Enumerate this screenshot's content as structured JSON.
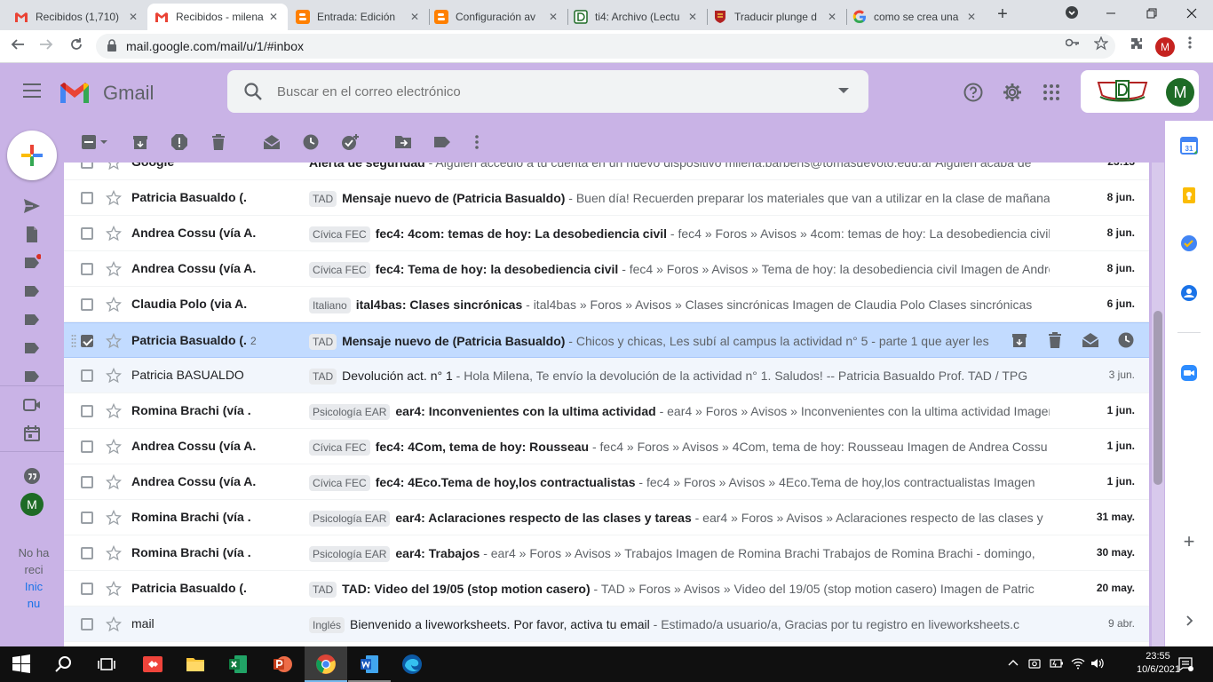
{
  "browser": {
    "tabs": [
      {
        "title": "Recibidos (1,710)",
        "icon": "gmail-icon",
        "active": false
      },
      {
        "title": "Recibidos - milena",
        "icon": "gmail-icon",
        "active": true
      },
      {
        "title": "Entrada: Edición",
        "icon": "blogger-icon",
        "active": false
      },
      {
        "title": "Configuración av",
        "icon": "blogger-icon",
        "active": false
      },
      {
        "title": "ti4: Archivo (Lectu",
        "icon": "moodle-icon",
        "active": false
      },
      {
        "title": "Traducir plunge d",
        "icon": "cambridge-icon",
        "active": false
      },
      {
        "title": "como se crea una",
        "icon": "google-icon",
        "active": false
      }
    ],
    "new_tab": "+",
    "url": "mail.google.com/mail/u/1/#inbox",
    "profile_initial": "M"
  },
  "gmail": {
    "logo_text": "Gmail",
    "search_placeholder": "Buscar en el correo electrónico",
    "account_initial": "M",
    "brand_color": "#ea4335"
  },
  "rail": {
    "footer_line1": "No ha",
    "footer_line2": "reci",
    "footer_link1": "Inic",
    "footer_link2": "nu",
    "avatar_initial": "M"
  },
  "emails": [
    {
      "sender": "Google",
      "count": "",
      "label": "",
      "subject": "Alerta de seguridad",
      "snippet": " - Alguien accedió a tu cuenta en un nuevo dispositivo milena.barberis@tomasdevoto.edu.ar Alguien acaba de",
      "date": "23:13",
      "read": false,
      "selected": false
    },
    {
      "sender": "Patricia Basualdo (.",
      "count": "",
      "label": "TAD",
      "subject": "Mensaje nuevo de (Patricia Basualdo)",
      "snippet": " - Buen día! Recuerden preparar los materiales que van a utilizar en la clase de mañana",
      "date": "8 jun.",
      "read": false,
      "selected": false
    },
    {
      "sender": "Andrea Cossu (vía A.",
      "count": "",
      "label": "Cívica FEC",
      "subject": "fec4: 4com: temas de hoy: La desobediencia civil",
      "snippet": " - fec4 » Foros » Avisos » 4com: temas de hoy: La desobediencia civil",
      "date": "8 jun.",
      "read": false,
      "selected": false
    },
    {
      "sender": "Andrea Cossu (vía A.",
      "count": "",
      "label": "Cívica FEC",
      "subject": "fec4: Tema de hoy: la desobediencia civil",
      "snippet": " - fec4 » Foros » Avisos » Tema de hoy: la desobediencia civil Imagen de Andrea",
      "date": "8 jun.",
      "read": false,
      "selected": false
    },
    {
      "sender": "Claudia Polo (via A.",
      "count": "",
      "label": "Italiano",
      "subject": "ital4bas: Clases sincrónicas",
      "snippet": " - ital4bas » Foros » Avisos » Clases sincrónicas Imagen de Claudia Polo Clases sincrónicas",
      "date": "6 jun.",
      "read": false,
      "selected": false
    },
    {
      "sender": "Patricia Basualdo (.",
      "count": "2",
      "label": "TAD",
      "subject": "Mensaje nuevo de (Patricia Basualdo)",
      "snippet": " - Chicos y chicas, Les subí al campus la actividad n° 5 - parte 1 que ayer les",
      "date": "",
      "read": false,
      "selected": true
    },
    {
      "sender": "Patricia BASUALDO",
      "count": "",
      "label": "TAD",
      "subject": "Devolución act. n° 1",
      "snippet": " - Hola Milena, Te envío la devolución de la actividad n° 1. Saludos! -- Patricia Basualdo Prof. TAD / TPG",
      "date": "3 jun.",
      "read": true,
      "selected": false
    },
    {
      "sender": "Romina Brachi (vía .",
      "count": "",
      "label": "Psicología EAR",
      "subject": "ear4: Inconvenientes con la ultima actividad",
      "snippet": " - ear4 » Foros » Avisos » Inconvenientes con la ultima actividad Imagen",
      "date": "1 jun.",
      "read": false,
      "selected": false
    },
    {
      "sender": "Andrea Cossu (vía A.",
      "count": "",
      "label": "Cívica FEC",
      "subject": "fec4: 4Com, tema de hoy: Rousseau",
      "snippet": " - fec4 » Foros » Avisos » 4Com, tema de hoy: Rousseau Imagen de Andrea Cossu",
      "date": "1 jun.",
      "read": false,
      "selected": false
    },
    {
      "sender": "Andrea Cossu (vía A.",
      "count": "",
      "label": "Cívica FEC",
      "subject": "fec4: 4Eco.Tema de hoy,los contractualistas",
      "snippet": " - fec4 » Foros » Avisos » 4Eco.Tema de hoy,los contractualistas Imagen",
      "date": "1 jun.",
      "read": false,
      "selected": false
    },
    {
      "sender": "Romina Brachi (vía .",
      "count": "",
      "label": "Psicología EAR",
      "subject": "ear4: Aclaraciones respecto de las clases y tareas",
      "snippet": " - ear4 » Foros » Avisos » Aclaraciones respecto de las clases y",
      "date": "31 may.",
      "read": false,
      "selected": false
    },
    {
      "sender": "Romina Brachi (vía .",
      "count": "",
      "label": "Psicología EAR",
      "subject": "ear4: Trabajos",
      "snippet": " - ear4 » Foros » Avisos » Trabajos Imagen de Romina Brachi Trabajos de Romina Brachi - domingo,",
      "date": "30 may.",
      "read": false,
      "selected": false
    },
    {
      "sender": "Patricia Basualdo (.",
      "count": "",
      "label": "TAD",
      "subject": "TAD: Video del 19/05 (stop motion casero)",
      "snippet": " - TAD » Foros » Avisos » Video del 19/05 (stop motion casero) Imagen de Patric",
      "date": "20 may.",
      "read": false,
      "selected": false
    },
    {
      "sender": "mail",
      "count": "",
      "label": "Inglés",
      "subject": "Bienvenido a liveworksheets. Por favor, activa tu email",
      "snippet": " - Estimado/a usuario/a, Gracias por tu registro en liveworksheets.c",
      "date": "9 abr.",
      "read": true,
      "selected": false
    }
  ],
  "taskbar": {
    "time": "23:55",
    "date": "10/6/2021"
  }
}
